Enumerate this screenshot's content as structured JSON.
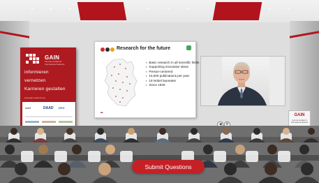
{
  "banner": {
    "brand": "GAIN",
    "tagline": "German Academic International Network",
    "menu": [
      "informieren",
      "vernetzen",
      "Karrieren gestalten"
    ],
    "url": "www.gain-network.org",
    "sponsors": [
      "DAAD",
      "DFG",
      "AvH"
    ]
  },
  "slide": {
    "title": "Research for the future",
    "bullets": [
      "Basic research in all scientific fields",
      "Supporting innovative ideas",
      "Person-centered",
      "15,000 publications per year",
      "18 Nobel laureates",
      "Since 1949"
    ],
    "dot_colors": [
      "#d12b2b",
      "#2c2c2c",
      "#e3a21a"
    ]
  },
  "podium": {
    "label": "GAIN",
    "sub": "German Academic International Network"
  },
  "controls": [
    {
      "icon": "previous-icon"
    },
    {
      "icon": "settings-icon"
    }
  ],
  "submit_label": "Submit Questions",
  "colors": {
    "accent": "#c42127",
    "banner": "#ad1a20"
  }
}
